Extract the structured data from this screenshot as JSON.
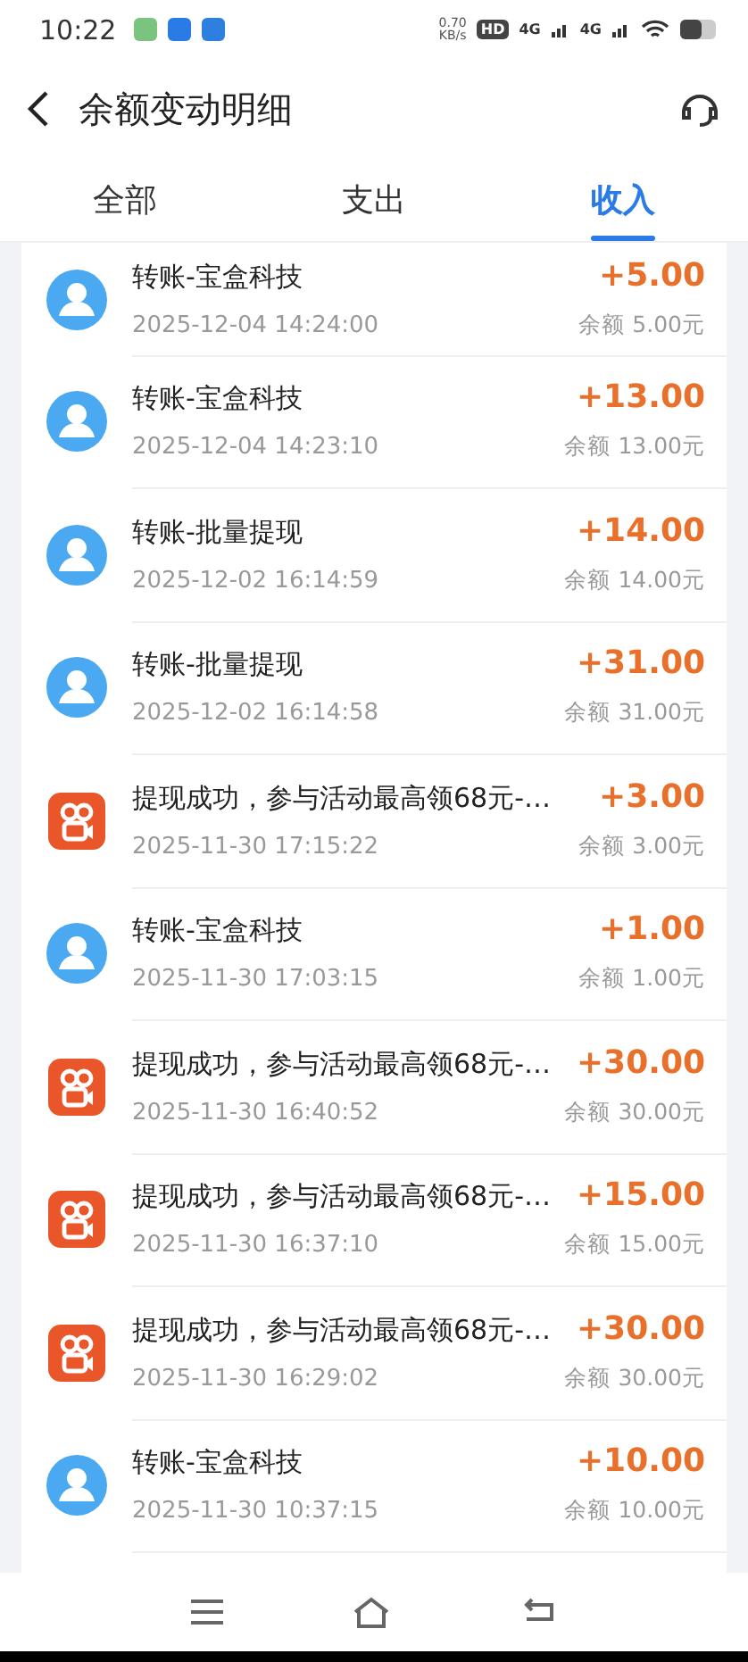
{
  "status_bar": {
    "time": "10:22",
    "speed": "0.70",
    "speed_unit": "KB/s",
    "hd": "HD",
    "network": [
      "4G",
      "4G"
    ]
  },
  "header": {
    "title": "余额变动明细"
  },
  "tabs": [
    {
      "label": "全部",
      "selected": false
    },
    {
      "label": "支出",
      "selected": false
    },
    {
      "label": "收入",
      "selected": true
    }
  ],
  "records": [
    {
      "kind": "transfer",
      "title": "转账-宝盒科技",
      "time": "2025-12-04 14:24:00",
      "amount": "+5.00",
      "balance": "余额 5.00元"
    },
    {
      "kind": "transfer",
      "title": "转账-宝盒科技",
      "time": "2025-12-04 14:23:10",
      "amount": "+13.00",
      "balance": "余额 13.00元"
    },
    {
      "kind": "transfer",
      "title": "转账-批量提现",
      "time": "2025-12-02 16:14:59",
      "amount": "+14.00",
      "balance": "余额 14.00元"
    },
    {
      "kind": "transfer",
      "title": "转账-批量提现",
      "time": "2025-12-02 16:14:58",
      "amount": "+31.00",
      "balance": "余额 31.00元"
    },
    {
      "kind": "app",
      "title": "提现成功，参与活动最高领68元-…",
      "time": "2025-11-30 17:15:22",
      "amount": "+3.00",
      "balance": "余额 3.00元"
    },
    {
      "kind": "transfer",
      "title": "转账-宝盒科技",
      "time": "2025-11-30 17:03:15",
      "amount": "+1.00",
      "balance": "余额 1.00元"
    },
    {
      "kind": "app",
      "title": "提现成功，参与活动最高领68元-…",
      "time": "2025-11-30 16:40:52",
      "amount": "+30.00",
      "balance": "余额 30.00元"
    },
    {
      "kind": "app",
      "title": "提现成功，参与活动最高领68元-…",
      "time": "2025-11-30 16:37:10",
      "amount": "+15.00",
      "balance": "余额 15.00元"
    },
    {
      "kind": "app",
      "title": "提现成功，参与活动最高领68元-…",
      "time": "2025-11-30 16:29:02",
      "amount": "+30.00",
      "balance": "余额 30.00元"
    },
    {
      "kind": "transfer",
      "title": "转账-宝盒科技",
      "time": "2025-11-30 10:37:15",
      "amount": "+10.00",
      "balance": "余额 10.00元"
    }
  ]
}
